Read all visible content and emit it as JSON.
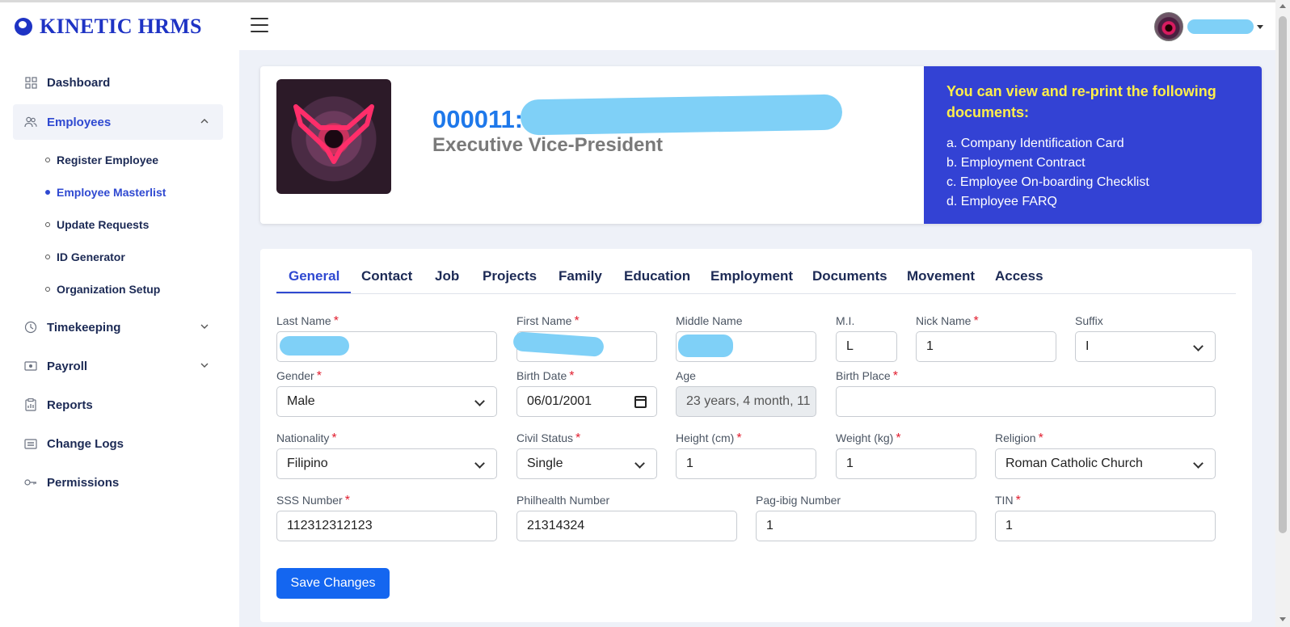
{
  "app": {
    "name": "KINETIC HRMS"
  },
  "sidebar": {
    "items": [
      {
        "label": "Dashboard",
        "icon": "dashboard-icon"
      },
      {
        "label": "Employees",
        "icon": "users-icon"
      },
      {
        "label": "Timekeeping",
        "icon": "clock-icon"
      },
      {
        "label": "Payroll",
        "icon": "cash-icon"
      },
      {
        "label": "Reports",
        "icon": "report-icon"
      },
      {
        "label": "Change Logs",
        "icon": "list-icon"
      },
      {
        "label": "Permissions",
        "icon": "key-icon"
      }
    ],
    "employee_subitems": [
      {
        "label": "Register Employee"
      },
      {
        "label": "Employee Masterlist"
      },
      {
        "label": "Update Requests"
      },
      {
        "label": "ID Generator"
      },
      {
        "label": "Organization Setup"
      }
    ]
  },
  "profile": {
    "employee_id": "000011:",
    "title": "Executive Vice-President",
    "documents_heading": "You can view and re-print the following documents:",
    "documents": [
      "a. Company Identification Card",
      "b. Employment Contract",
      "c. Employee On-boarding Checklist",
      "d. Employee FARQ"
    ]
  },
  "tabs": [
    "General",
    "Contact",
    "Job",
    "Projects",
    "Family",
    "Education",
    "Employment",
    "Documents",
    "Movement",
    "Access"
  ],
  "form": {
    "last_name": {
      "label": "Last Name",
      "required": "*"
    },
    "first_name": {
      "label": "First Name",
      "required": "*"
    },
    "middle_name": {
      "label": "Middle Name"
    },
    "mi": {
      "label": "M.I.",
      "value": "L"
    },
    "nick_name": {
      "label": "Nick Name",
      "required": "*",
      "value": "1"
    },
    "suffix": {
      "label": "Suffix",
      "value": "I"
    },
    "gender": {
      "label": "Gender",
      "required": "*",
      "value": "Male"
    },
    "birth_date": {
      "label": "Birth Date",
      "required": "*",
      "value": "06/01/2001"
    },
    "age": {
      "label": "Age",
      "value": "23 years, 4 month, 11"
    },
    "birth_place": {
      "label": "Birth Place",
      "required": "*",
      "value": ""
    },
    "nationality": {
      "label": "Nationality",
      "required": "*",
      "value": "Filipino"
    },
    "civil_status": {
      "label": "Civil Status",
      "required": "*",
      "value": "Single"
    },
    "height": {
      "label": "Height (cm)",
      "required": "*",
      "value": "1"
    },
    "weight": {
      "label": "Weight (kg)",
      "required": "*",
      "value": "1"
    },
    "religion": {
      "label": "Religion",
      "required": "*",
      "value": "Roman Catholic Church"
    },
    "sss": {
      "label": "SSS Number",
      "required": "*",
      "value": "112312312123"
    },
    "philhealth": {
      "label": "Philhealth Number",
      "value": "21314324"
    },
    "pagibig": {
      "label": "Pag-ibig Number",
      "value": "1"
    },
    "tin": {
      "label": "TIN",
      "required": "*",
      "value": "1"
    },
    "save_label": "Save Changes"
  },
  "colors": {
    "brand": "#1e33c4",
    "accent": "#2f49d1",
    "doc_panel": "#3342d4",
    "save": "#1466f0",
    "redaction": "#7fd0f7"
  }
}
